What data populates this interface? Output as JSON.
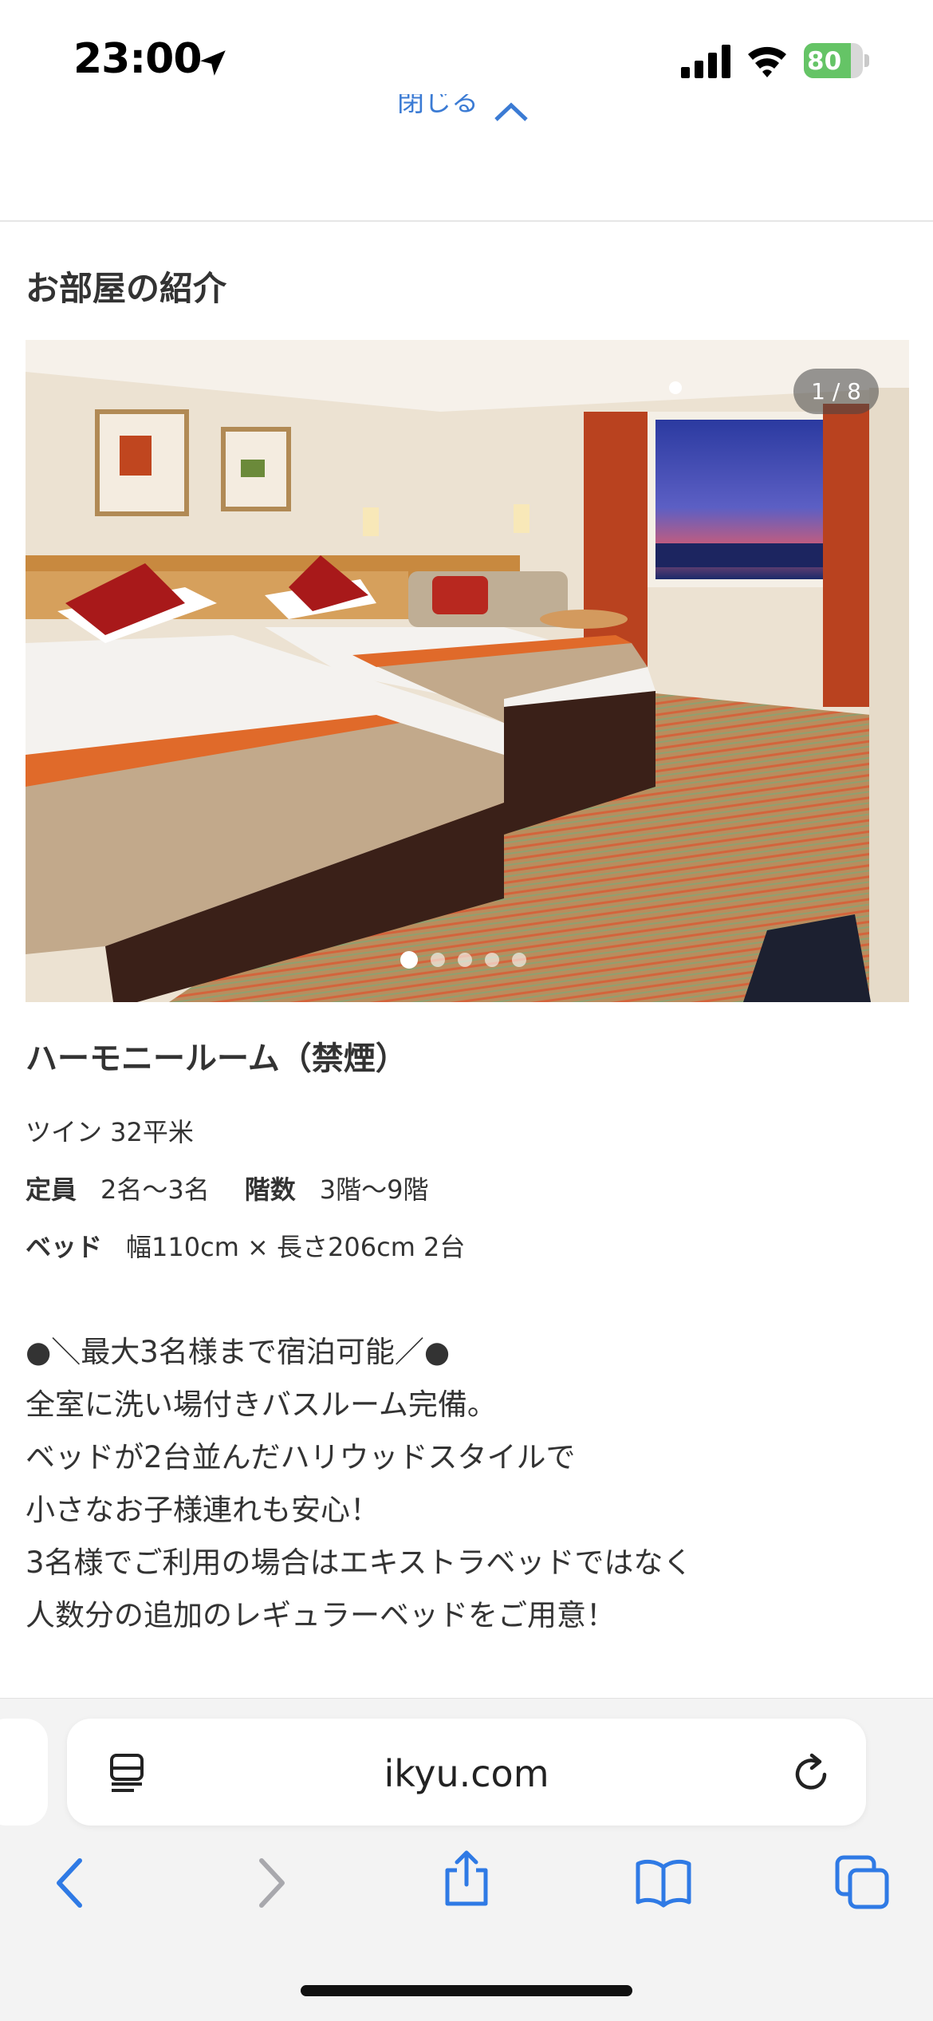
{
  "status_bar": {
    "time": "23:00",
    "battery": "80",
    "battery_level": 0.8
  },
  "header": {
    "close_label": "閉じる"
  },
  "section": {
    "title": "お部屋の紹介"
  },
  "carousel": {
    "counter": "1 / 8",
    "dot_count": 5,
    "active_index": 0
  },
  "room": {
    "name": "ハーモニールーム（禁煙）",
    "type": "ツイン 32平米",
    "capacity_label": "定員",
    "capacity_value": "2名〜3名",
    "floor_label": "階数",
    "floor_value": "3階〜9階",
    "bed_label": "ベッド",
    "bed_value": "幅110cm × 長さ206cm 2台"
  },
  "description": [
    "●＼最大3名様まで宿泊可能／●",
    "全室に洗い場付きバスルーム完備。",
    "ベッドが2台並んだハリウッドスタイルで",
    "小さなお子様連れも安心！",
    "3名様でご利用の場合はエキストラベッドではなく",
    "人数分の追加のレギュラーベッドをご用意！"
  ],
  "browser": {
    "url": "ikyu.com"
  },
  "colors": {
    "accent": "#3b7bd4",
    "battery_green": "#65c466",
    "toolbar_blue": "#2f7ae5"
  }
}
